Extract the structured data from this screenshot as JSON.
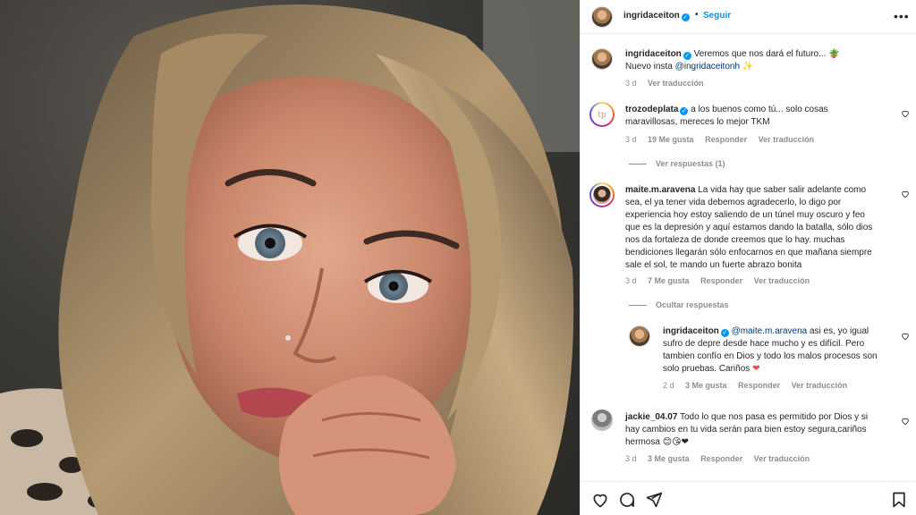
{
  "post": {
    "author": "ingridaceiton",
    "follow_label": "Seguir",
    "more_label": "•••",
    "caption_line1": "Veremos que nos dará el futuro... 🪴",
    "caption_line2_prefix": "Nuevo insta ",
    "caption_mention": "@ingridaceitonh",
    "caption_emoji": "✨",
    "caption_time": "3 d",
    "caption_translate": "Ver traducción"
  },
  "comments": [
    {
      "user": "trozodeplata",
      "verified": true,
      "line1": "a los buenos como tú... solo cosas",
      "line2": "maravillosas, mereces lo mejor TKM",
      "time": "3 d",
      "likes": "19 Me gusta",
      "reply": "Responder",
      "translate": "Ver traducción",
      "toggle": "Ver respuestas (1)"
    },
    {
      "user": "maite.m.aravena",
      "lines": [
        "La vida hay que saber salir adelante como",
        "sea, el ya tener vida debemos agradecerlo, lo digo por",
        "experiencia hoy estoy saliendo de un túnel muy oscuro y feo",
        "que es la depresión y aquí estamos dando la batalla, sólo dios",
        "nos da fortaleza de donde creemos que lo hay. muchas",
        "bendiciones llegarán sólo enfocarnos en que mañana siempre",
        "sale el sol, te mando un fuerte abrazo bonita"
      ],
      "time": "3 d",
      "likes": "7 Me gusta",
      "reply": "Responder",
      "translate": "Ver traducción",
      "toggle": "Ocultar respuestas"
    },
    {
      "user": "ingridaceiton",
      "verified": true,
      "mention": "@maite.m.aravena",
      "line1_rest": " asi es, yo igual",
      "lines": [
        "sufro de depre desde hace mucho y es difícil. Pero",
        "tambien confío en Dios y todo los malos procesos son"
      ],
      "last_line": "solo pruebas. Cariños ",
      "heart": "❤",
      "time": "2 d",
      "likes": "3 Me gusta",
      "reply": "Responder",
      "translate": "Ver traducción"
    },
    {
      "user": "jackie_04.07",
      "line1": "Todo lo que nos pasa es permitido por Dios y si",
      "line2": "hay cambios en tu vida serán para bien estoy segura,cariños",
      "line3": "hermosa ",
      "emojis": "😊😘❤",
      "time": "3 d",
      "likes": "3 Me gusta",
      "reply": "Responder",
      "translate": "Ver traducción"
    }
  ],
  "actions": {
    "like_icon": "heart-icon",
    "comment_icon": "comment-icon",
    "share_icon": "send-icon",
    "save_icon": "bookmark-icon"
  },
  "colors": {
    "link_blue": "#0095f6",
    "muted": "#8e8e8e",
    "text": "#262626",
    "heart_red": "#ed4956"
  }
}
